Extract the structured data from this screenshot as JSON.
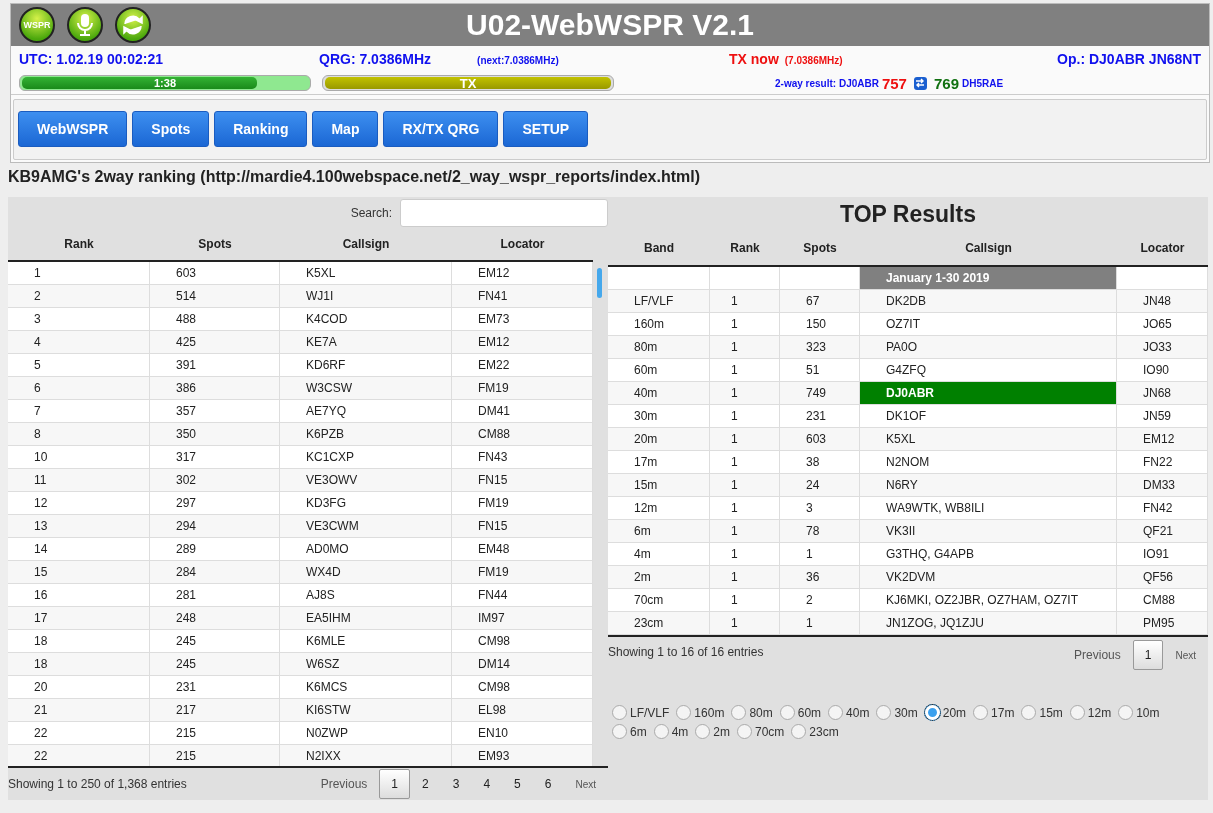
{
  "header": {
    "logo_text": "WSPR",
    "title": "U02-WebWSPR V2.1"
  },
  "info": {
    "utc": "UTC: 1.02.19 00:02:21",
    "qrg": "QRG: 7.0386MHz",
    "next": "(next:7.0386MHz)",
    "tx_now": "TX now",
    "tx_freq": "(7.0386MHz)",
    "operator": "Op.: DJ0ABR JN68NT"
  },
  "progress": [
    {
      "label": "1:38",
      "level": 0.82,
      "kind": "timer"
    },
    {
      "label": "TX",
      "level": 1,
      "kind": "tx"
    }
  ],
  "two_way": {
    "label": "2-way result: DJ0ABR",
    "own": "757",
    "other": "769",
    "other_call": "DH5RAE"
  },
  "nav": [
    {
      "label": "WebWSPR"
    },
    {
      "label": "Spots"
    },
    {
      "label": "Ranking"
    },
    {
      "label": "Map"
    },
    {
      "label": "RX/TX QRG"
    },
    {
      "label": "SETUP"
    }
  ],
  "page_title": "KB9AMG's 2way ranking (http://mardie4.100webspace.net/2_way_wspr_reports/index.html)",
  "ranking": {
    "search_label": "Search:",
    "columns": [
      "Rank",
      "Spots",
      "Callsign",
      "Locator"
    ],
    "rows": [
      [
        "1",
        "603",
        "K5XL",
        "EM12"
      ],
      [
        "2",
        "514",
        "WJ1I",
        "FN41"
      ],
      [
        "3",
        "488",
        "K4COD",
        "EM73"
      ],
      [
        "4",
        "425",
        "KE7A",
        "EM12"
      ],
      [
        "5",
        "391",
        "KD6RF",
        "EM22"
      ],
      [
        "6",
        "386",
        "W3CSW",
        "FM19"
      ],
      [
        "7",
        "357",
        "AE7YQ",
        "DM41"
      ],
      [
        "8",
        "350",
        "K6PZB",
        "CM88"
      ],
      [
        "10",
        "317",
        "KC1CXP",
        "FN43"
      ],
      [
        "11",
        "302",
        "VE3OWV",
        "FN15"
      ],
      [
        "12",
        "297",
        "KD3FG",
        "FM19"
      ],
      [
        "13",
        "294",
        "VE3CWM",
        "FN15"
      ],
      [
        "14",
        "289",
        "AD0MO",
        "EM48"
      ],
      [
        "15",
        "284",
        "WX4D",
        "FM19"
      ],
      [
        "16",
        "281",
        "AJ8S",
        "FN44"
      ],
      [
        "17",
        "248",
        "EA5IHM",
        "IM97"
      ],
      [
        "18",
        "245",
        "K6MLE",
        "CM98"
      ],
      [
        "18",
        "245",
        "W6SZ",
        "DM14"
      ],
      [
        "20",
        "231",
        "K6MCS",
        "CM98"
      ],
      [
        "21",
        "217",
        "KI6STW",
        "EL98"
      ],
      [
        "22",
        "215",
        "N0ZWP",
        "EN10"
      ],
      [
        "22",
        "215",
        "N2IXX",
        "EM93"
      ]
    ],
    "info": "Showing 1 to 250 of 1,368 entries",
    "pager": {
      "previous": "Previous",
      "next": "Next",
      "pages": [
        {
          "label": "1",
          "selected": true
        },
        {
          "label": "2",
          "selected": false
        },
        {
          "label": "3",
          "selected": false
        },
        {
          "label": "4",
          "selected": false
        },
        {
          "label": "5",
          "selected": false
        },
        {
          "label": "6",
          "selected": false
        }
      ]
    }
  },
  "top": {
    "title": "TOP Results",
    "columns": [
      "Band",
      "Rank",
      "Spots",
      "Callsign",
      "Locator"
    ],
    "period": "January 1-30 2019",
    "rows": [
      {
        "cells": [
          "LF/VLF",
          "1",
          "67",
          "DK2DB",
          "JN48"
        ],
        "highlighted": false
      },
      {
        "cells": [
          "160m",
          "1",
          "150",
          "OZ7IT",
          "JO65"
        ],
        "highlighted": false
      },
      {
        "cells": [
          "80m",
          "1",
          "323",
          "PA0O",
          "JO33"
        ],
        "highlighted": false
      },
      {
        "cells": [
          "60m",
          "1",
          "51",
          "G4ZFQ",
          "IO90"
        ],
        "highlighted": false
      },
      {
        "cells": [
          "40m",
          "1",
          "749",
          "DJ0ABR",
          "JN68"
        ],
        "highlighted": true
      },
      {
        "cells": [
          "30m",
          "1",
          "231",
          "DK1OF",
          "JN59"
        ],
        "highlighted": false
      },
      {
        "cells": [
          "20m",
          "1",
          "603",
          "K5XL",
          "EM12"
        ],
        "highlighted": false
      },
      {
        "cells": [
          "17m",
          "1",
          "38",
          "N2NOM",
          "FN22"
        ],
        "highlighted": false
      },
      {
        "cells": [
          "15m",
          "1",
          "24",
          "N6RY",
          "DM33"
        ],
        "highlighted": false
      },
      {
        "cells": [
          "12m",
          "1",
          "3",
          "WA9WTK, WB8ILI",
          "FN42"
        ],
        "highlighted": false
      },
      {
        "cells": [
          "6m",
          "1",
          "78",
          "VK3II",
          "QF21"
        ],
        "highlighted": false
      },
      {
        "cells": [
          "4m",
          "1",
          "1",
          "G3THQ, G4APB",
          "IO91"
        ],
        "highlighted": false
      },
      {
        "cells": [
          "2m",
          "1",
          "36",
          "VK2DVM",
          "QF56"
        ],
        "highlighted": false
      },
      {
        "cells": [
          "70cm",
          "1",
          "2",
          "KJ6MKI, OZ2JBR, OZ7HAM, OZ7IT",
          "CM88"
        ],
        "highlighted": false
      },
      {
        "cells": [
          "23cm",
          "1",
          "1",
          "JN1ZOG, JQ1ZJU",
          "PM95"
        ],
        "highlighted": false
      }
    ],
    "info": "Showing 1 to 16 of 16 entries",
    "pager": {
      "previous": "Previous",
      "next": "Next",
      "pages": [
        {
          "label": "1",
          "selected": true
        }
      ]
    },
    "bands": [
      {
        "label": "LF/VLF",
        "selected": false
      },
      {
        "label": "160m",
        "selected": false
      },
      {
        "label": "80m",
        "selected": false
      },
      {
        "label": "60m",
        "selected": false
      },
      {
        "label": "40m",
        "selected": false
      },
      {
        "label": "30m",
        "selected": false
      },
      {
        "label": "20m",
        "selected": true
      },
      {
        "label": "17m",
        "selected": false
      },
      {
        "label": "15m",
        "selected": false
      },
      {
        "label": "12m",
        "selected": false
      },
      {
        "label": "10m",
        "selected": false
      },
      {
        "label": "6m",
        "selected": false
      },
      {
        "label": "4m",
        "selected": false
      },
      {
        "label": "2m",
        "selected": false
      },
      {
        "label": "70cm",
        "selected": false
      },
      {
        "label": "23cm",
        "selected": false
      }
    ]
  }
}
